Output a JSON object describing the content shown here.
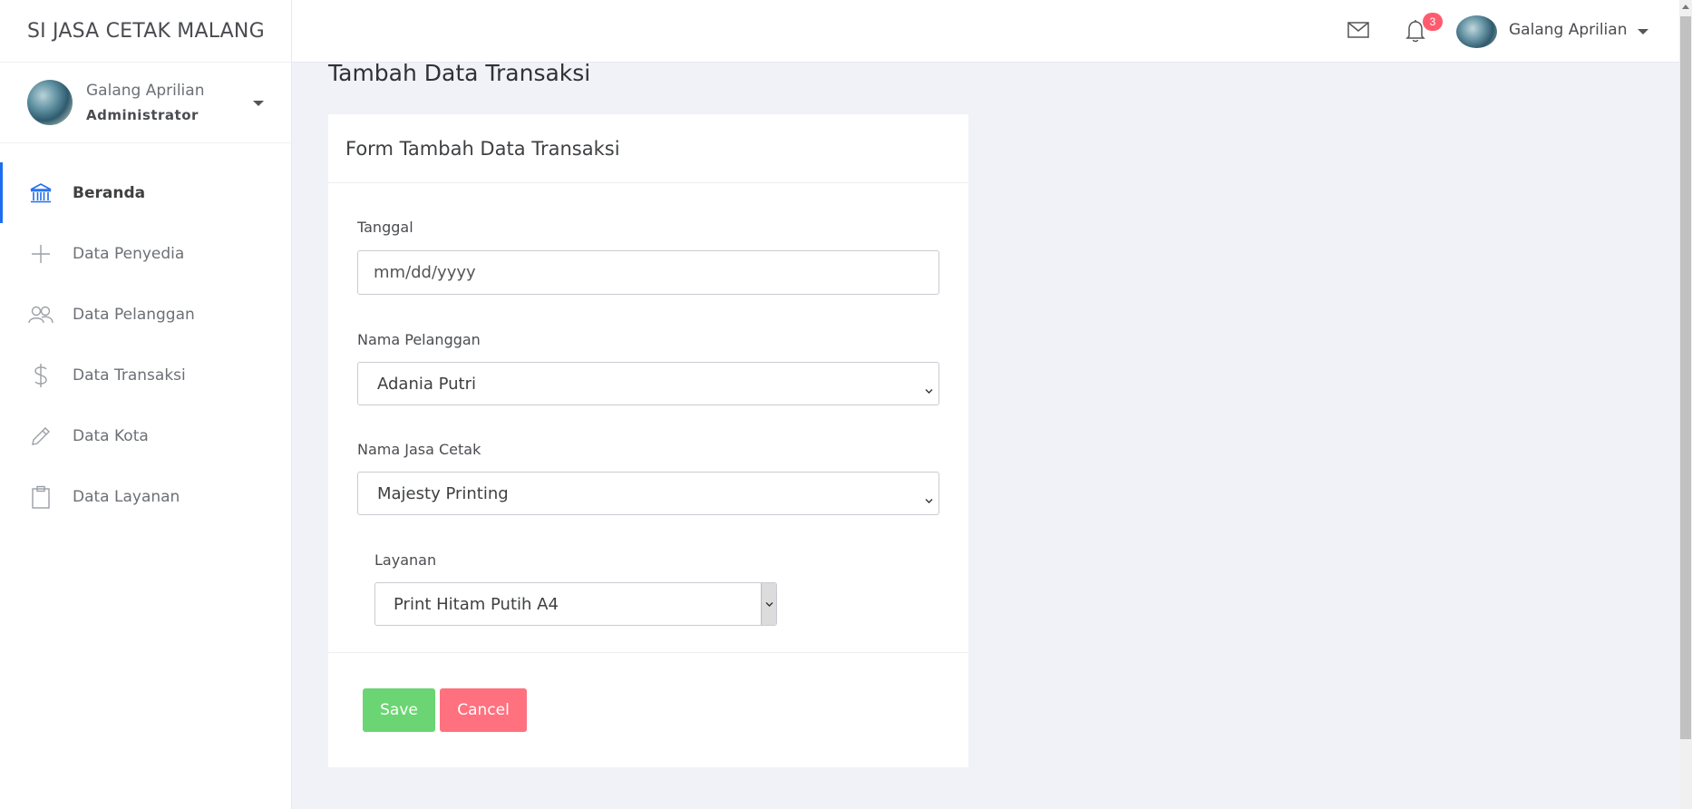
{
  "brand": "SI JASA CETAK MALANG",
  "profile": {
    "name": "Galang Aprilian",
    "role": "Administrator"
  },
  "nav": [
    {
      "label": "Beranda",
      "icon": "bank-icon",
      "active": true
    },
    {
      "label": "Data Penyedia",
      "icon": "plus-icon",
      "active": false
    },
    {
      "label": "Data Pelanggan",
      "icon": "users-icon",
      "active": false
    },
    {
      "label": "Data Transaksi",
      "icon": "dollar-icon",
      "active": false
    },
    {
      "label": "Data Kota",
      "icon": "pencil-icon",
      "active": false
    },
    {
      "label": "Data Layanan",
      "icon": "clipboard-icon",
      "active": false
    }
  ],
  "topbar": {
    "user_name": "Galang Aprilian",
    "notification_count": "3"
  },
  "page_title": "Tambah Data Transaksi",
  "form": {
    "title": "Form Tambah Data Transaksi",
    "tanggal": {
      "label": "Tanggal",
      "placeholder": "mm/dd/yyyy"
    },
    "pelanggan": {
      "label": "Nama Pelanggan",
      "value": "Adania Putri"
    },
    "jasa_cetak": {
      "label": "Nama Jasa Cetak",
      "value": "Majesty Printing"
    },
    "layanan": {
      "label": "Layanan",
      "value": "Print Hitam Putih A4"
    },
    "save_label": "Save",
    "cancel_label": "Cancel"
  },
  "colors": {
    "accent": "#1e6df0",
    "save": "#6bd573",
    "cancel": "#ff717f",
    "badge": "#ff5b6f"
  }
}
